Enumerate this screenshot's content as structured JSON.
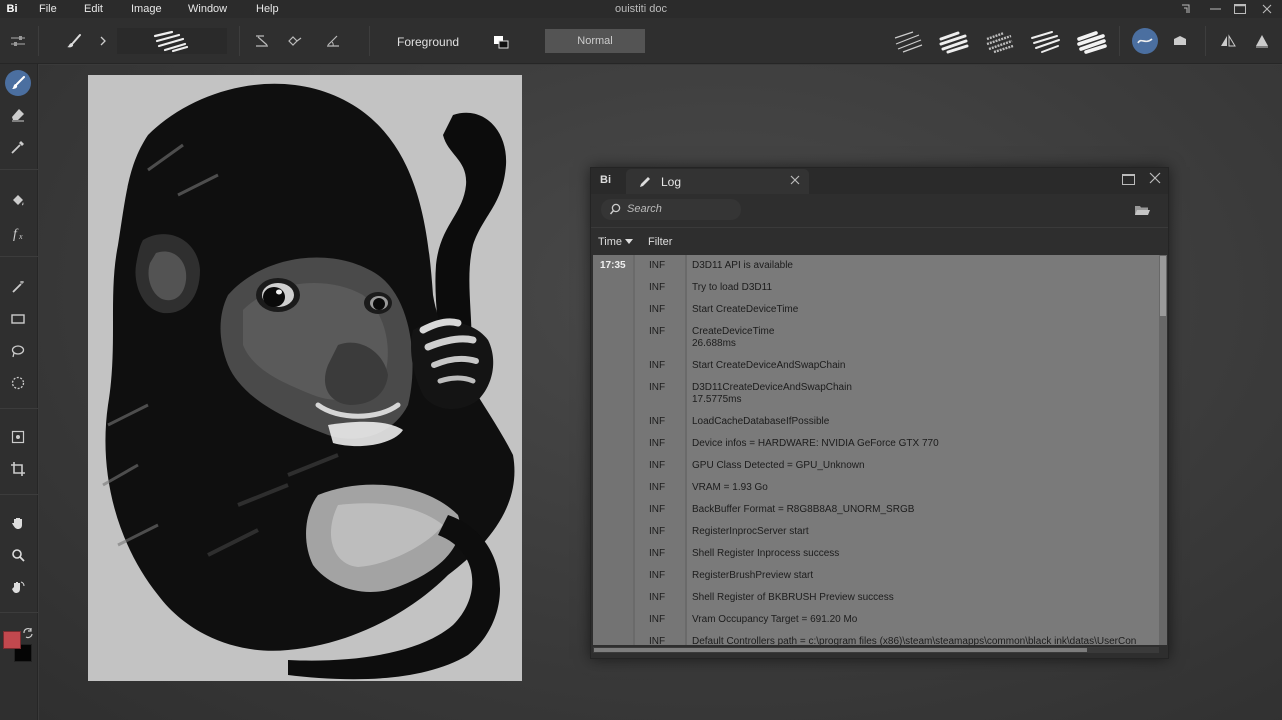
{
  "menubar": {
    "logo": "Bi",
    "menus": [
      "File",
      "Edit",
      "Image",
      "Window",
      "Help"
    ],
    "document_title": "ouistiti doc",
    "window_controls": [
      "pin-icon",
      "minimize-icon",
      "maximize-icon",
      "close-icon"
    ]
  },
  "toolbar": {
    "left_icon": "sliders-icon",
    "brush_icon": "brush-icon",
    "expand_icon": "chevron-right-icon",
    "symmetry_icons": [
      "symmetry-icon",
      "stabilizer-icon",
      "angle-icon"
    ],
    "color_mode_label": "Foreground",
    "blend_mode": "Normal",
    "brush_presets": [
      "preset-1",
      "preset-2",
      "preset-3",
      "preset-4",
      "preset-5"
    ],
    "right_icons": [
      "wet-mode-icon",
      "tablet-icon",
      "flip-icon",
      "mirror-icon"
    ]
  },
  "tools": [
    {
      "name": "brush-tool",
      "icon": "brush-icon",
      "active": true
    },
    {
      "name": "eraser-tool",
      "icon": "eraser-icon",
      "active": false
    },
    {
      "name": "color-picker-tool",
      "icon": "eyedropper-icon",
      "active": false
    },
    {
      "name": "fill-tool",
      "icon": "bucket-icon",
      "active": false
    },
    {
      "name": "filter-tool",
      "icon": "function-icon",
      "active": false
    },
    {
      "name": "magic-wand-tool",
      "icon": "wand-icon",
      "active": false
    },
    {
      "name": "rect-select-tool",
      "icon": "rectangle-icon",
      "active": false
    },
    {
      "name": "lasso-tool",
      "icon": "lasso-icon",
      "active": false
    },
    {
      "name": "ellipse-select-tool",
      "icon": "ellipse-icon",
      "active": false
    },
    {
      "name": "transform-tool",
      "icon": "transform-icon",
      "active": false
    },
    {
      "name": "crop-tool",
      "icon": "crop-icon",
      "active": false
    },
    {
      "name": "pan-tool",
      "icon": "hand-icon",
      "active": false
    },
    {
      "name": "zoom-tool",
      "icon": "zoom-icon",
      "active": false
    },
    {
      "name": "rotate-tool",
      "icon": "rotate-icon",
      "active": false
    }
  ],
  "colors": {
    "primary": "#c2484e",
    "secondary": "#050505",
    "active_tool": "#4b6fa0"
  },
  "log": {
    "app_badge": "Bi",
    "tab_title": "Log",
    "tab_icon": "pencil-icon",
    "search_placeholder": "Search",
    "folder_icon": "folder-icon",
    "columns": {
      "time": "Time",
      "filter": "Filter"
    },
    "rows": [
      {
        "time": "17:35",
        "level": "INF",
        "message": "D3D11 API is available"
      },
      {
        "time": "",
        "level": "INF",
        "message": "Try to load D3D11"
      },
      {
        "time": "",
        "level": "INF",
        "message": "Start CreateDeviceTime"
      },
      {
        "time": "",
        "level": "INF",
        "message": "CreateDeviceTime\n26.688ms"
      },
      {
        "time": "",
        "level": "INF",
        "message": "Start CreateDeviceAndSwapChain"
      },
      {
        "time": "",
        "level": "INF",
        "message": "D3D11CreateDeviceAndSwapChain\n17.5775ms"
      },
      {
        "time": "",
        "level": "INF",
        "message": "LoadCacheDatabaseIfPossible"
      },
      {
        "time": "",
        "level": "INF",
        "message": "Device infos = HARDWARE: NVIDIA GeForce GTX 770"
      },
      {
        "time": "",
        "level": "INF",
        "message": "GPU Class Detected = GPU_Unknown"
      },
      {
        "time": "",
        "level": "INF",
        "message": "VRAM = 1.93 Go"
      },
      {
        "time": "",
        "level": "INF",
        "message": "BackBuffer Format = R8G8B8A8_UNORM_SRGB"
      },
      {
        "time": "",
        "level": "INF",
        "message": "RegisterInprocServer start"
      },
      {
        "time": "",
        "level": "INF",
        "message": "Shell Register Inprocess success"
      },
      {
        "time": "",
        "level": "INF",
        "message": "RegisterBrushPreview start"
      },
      {
        "time": "",
        "level": "INF",
        "message": "Shell Register of BKBRUSH Preview success"
      },
      {
        "time": "",
        "level": "INF",
        "message": "Vram Occupancy Target = 691.20 Mo"
      },
      {
        "time": "",
        "level": "INF",
        "message": "Default Controllers path = c:\\program files (x86)\\steam\\steamapps\\common\\black ink\\datas\\UserCon"
      }
    ]
  }
}
